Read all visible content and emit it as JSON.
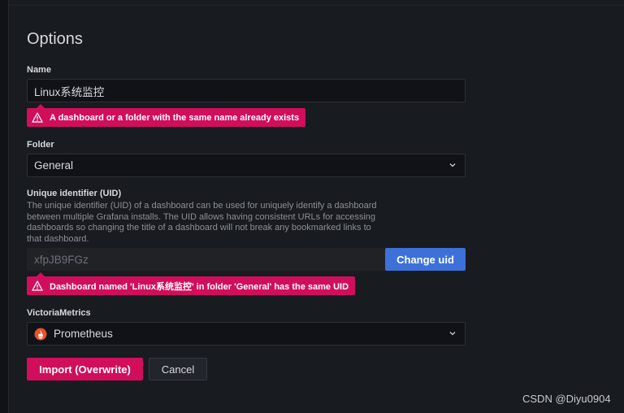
{
  "top": {
    "left_text": "Options",
    "right_text": ""
  },
  "options": {
    "heading": "Options",
    "name": {
      "label": "Name",
      "value": "Linux系统监控",
      "error": "A dashboard or a folder with the same name already exists"
    },
    "folder": {
      "label": "Folder",
      "value": "General"
    },
    "uid": {
      "label": "Unique identifier (UID)",
      "description": "The unique identifier (UID) of a dashboard can be used for uniquely identify a dashboard between multiple Grafana installs. The UID allows having consistent URLs for accessing dashboards so changing the title of a dashboard will not break any bookmarked links to that dashboard.",
      "value": "xfpJB9FGz",
      "change_button": "Change uid",
      "error": "Dashboard named 'Linux系统监控' in folder 'General' has the same UID"
    },
    "datasource": {
      "label": "VictoriaMetrics",
      "value": "Prometheus",
      "icon": "prometheus-icon"
    },
    "actions": {
      "import_label": "Import (Overwrite)",
      "cancel_label": "Cancel"
    }
  },
  "watermark": "CSDN @Diyu0904",
  "colors": {
    "error": "#d10e5c",
    "primary": "#3d71d9",
    "background": "#181b1f"
  }
}
